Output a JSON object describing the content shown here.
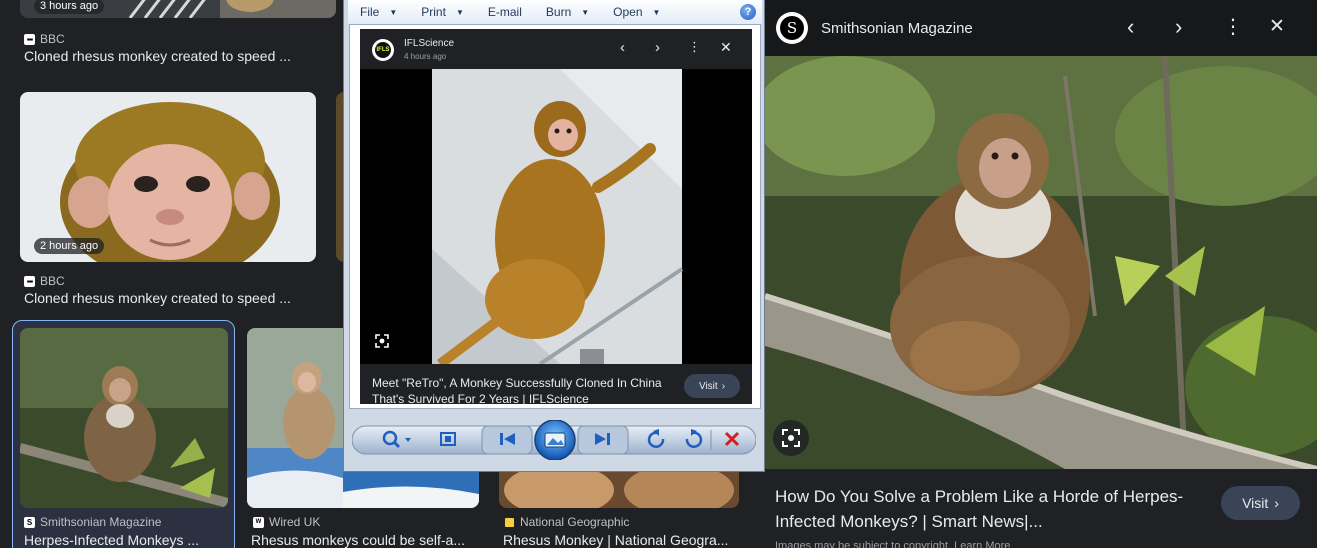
{
  "results": {
    "item1": {
      "time": "3 hours ago",
      "source": "BBC",
      "title": "Cloned rhesus monkey created to speed ..."
    },
    "item2": {
      "time": "2 hours ago",
      "source": "BBC",
      "title": "Cloned rhesus monkey created to speed ..."
    },
    "item3": {
      "source": "Smithsonian Magazine",
      "title": "Herpes-Infected Monkeys ..."
    },
    "item4": {
      "source": "Wired UK",
      "title": "Rhesus monkeys could be self-a..."
    },
    "item5": {
      "source": "National Geographic",
      "title": "Rhesus Monkey | National Geogra..."
    }
  },
  "viewer": {
    "menu": [
      "File",
      "Print",
      "E-mail",
      "Burn",
      "Open"
    ],
    "help": "?",
    "card": {
      "source": "IFLScience",
      "logo_text": "IFLS",
      "time": "4 hours ago",
      "title": "Meet \"ReTro\", A Monkey Successfully Cloned In China That's Survived For 2 Years | IFLScience",
      "visit": "Visit"
    }
  },
  "panel": {
    "logo_letter": "S",
    "source": "Smithsonian Magazine",
    "title": "How Do You Solve a Problem Like a Horde of Herpes-Infected Monkeys? | Smart News|...",
    "visit": "Visit",
    "copyright": "Images may be subject to copyright. Learn More"
  }
}
